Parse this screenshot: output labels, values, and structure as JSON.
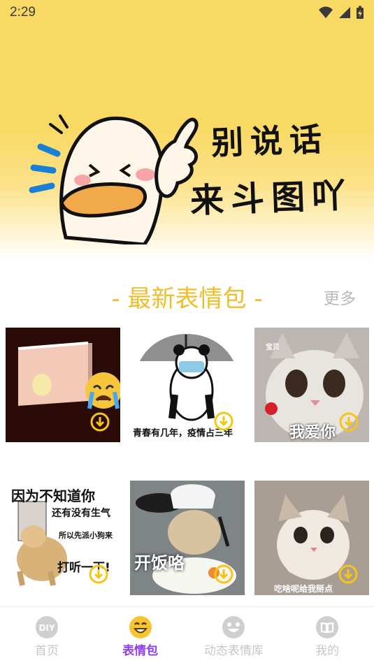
{
  "status_bar": {
    "time": "2:29"
  },
  "banner": {
    "line1": "别说话",
    "line2": "来斗图吖"
  },
  "section": {
    "title": "最新表情包",
    "dash": "-",
    "more": "更多"
  },
  "stickers": [
    {
      "caption": "",
      "badge": ""
    },
    {
      "caption": "青春有几年，疫情占三年",
      "badge": ""
    },
    {
      "caption": "我爱你",
      "badge": "宝贝"
    },
    {
      "caption_lines": [
        "因为不知道你",
        "还有没有生气",
        "所以先派小狗来",
        "打听一下!"
      ]
    },
    {
      "caption": "开饭咯"
    },
    {
      "caption": "吃啥呢给我掰点"
    }
  ],
  "nav": {
    "items": [
      {
        "label": "首页",
        "icon": "diy-icon",
        "badge_text": "DIY"
      },
      {
        "label": "表情包",
        "icon": "smile-emoji-icon"
      },
      {
        "label": "动态表情库",
        "icon": "smile-face-icon"
      },
      {
        "label": "我的",
        "icon": "book-icon"
      }
    ]
  },
  "colors": {
    "banner_yellow": "#f8d964",
    "section_title": "#f1bd2a",
    "more_text": "#b9b9b9",
    "nav_active": "#8e3cf0",
    "nav_inactive": "#c7c7c7",
    "download_circle": "#f5c518"
  }
}
